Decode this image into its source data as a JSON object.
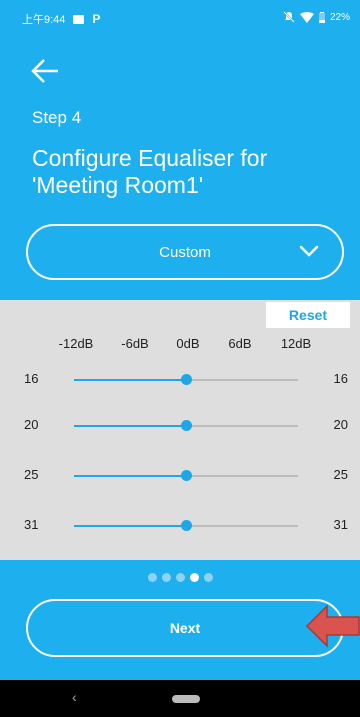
{
  "status": {
    "time": "上午9:44",
    "battery": "22%"
  },
  "header": {
    "step": "Step 4",
    "title": "Configure Equaliser for 'Meeting Room1'"
  },
  "preset": {
    "selected": "Custom"
  },
  "equaliser": {
    "reset_label": "Reset",
    "db_labels": [
      "-12dB",
      "-6dB",
      "0dB",
      "6dB",
      "12dB"
    ],
    "bands": [
      {
        "freq": "16",
        "value_db": 0
      },
      {
        "freq": "20",
        "value_db": 0
      },
      {
        "freq": "25",
        "value_db": 0
      },
      {
        "freq": "31",
        "value_db": 0
      }
    ]
  },
  "pager": {
    "count": 5,
    "active_index": 3
  },
  "footer": {
    "next_label": "Next"
  },
  "colors": {
    "accent": "#1eb0ee",
    "slider": "#1ea6e6",
    "panel": "#dedede",
    "arrow": "#d9534f"
  },
  "icons": [
    "back-arrow-icon",
    "chevron-down-icon",
    "image-icon",
    "parking-icon",
    "mute-icon",
    "wifi-icon",
    "battery-icon",
    "nav-back-icon"
  ]
}
